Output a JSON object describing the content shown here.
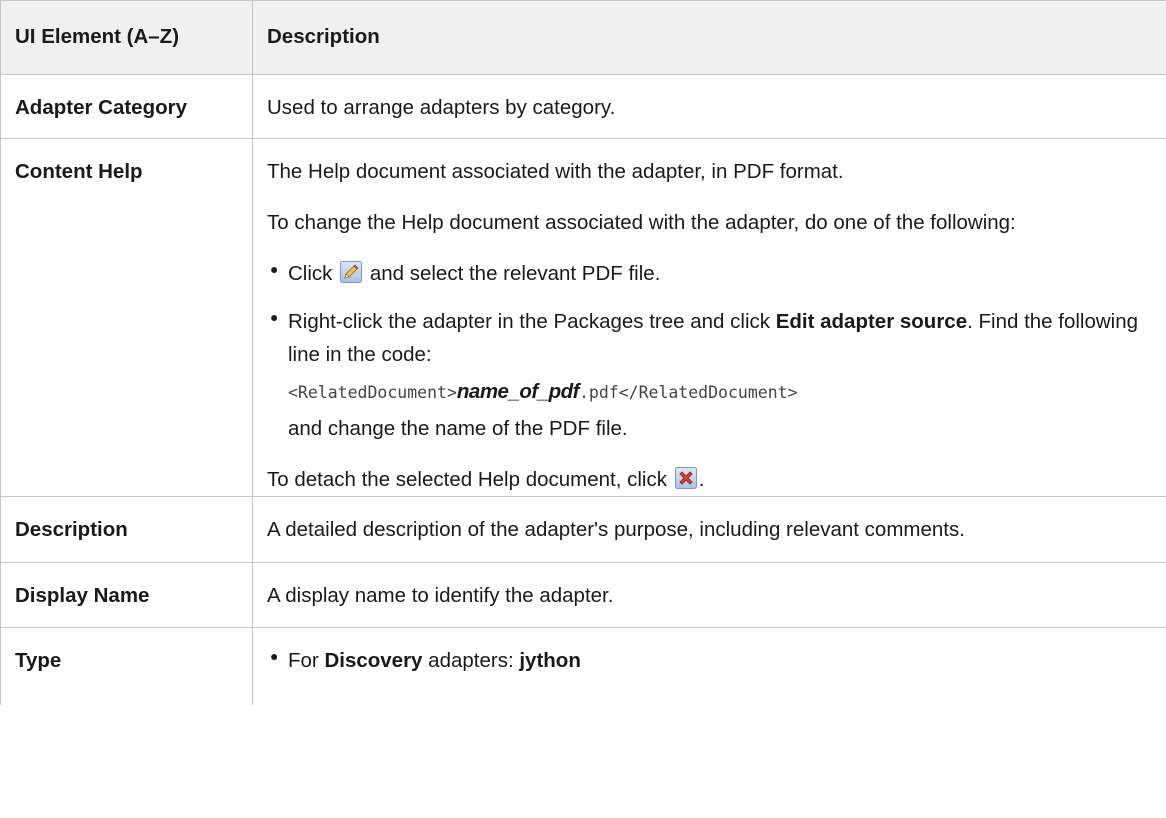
{
  "table": {
    "headers": {
      "element": "UI Element (A–Z)",
      "description": "Description"
    },
    "rows": {
      "adapter_category": {
        "element": "Adapter Category",
        "description": "Used to arrange adapters by category."
      },
      "content_help": {
        "element": "Content Help",
        "p1": "The Help document associated with the adapter, in PDF format.",
        "p2": "To change the Help document associated with the adapter, do one of the following:",
        "bullet1_before": "Click",
        "bullet1_after": "and select the relevant PDF file.",
        "bullet2_part1": "Right-click the adapter in the Packages tree and click",
        "bullet2_bold1": "Edit adapter source",
        "bullet2_part2": ". Find the following line in the code:",
        "code_prefix": "<RelatedDocument>",
        "code_italic": "name_of_pdf",
        "code_suffix": ".pdf</RelatedDocument>",
        "bullet2_tail": "and change the name of the PDF file.",
        "p3_before": "To detach the selected Help document, click",
        "p3_after": "."
      },
      "description": {
        "element": "Description",
        "description": "A detailed description of the adapter's purpose, including relevant comments."
      },
      "display_name": {
        "element": "Display Name",
        "description": "A display name to identify the adapter."
      },
      "type": {
        "element": "Type",
        "bullet_before": "For",
        "bullet_bold1": "Discovery",
        "bullet_middle": "adapters:",
        "bullet_bold2": "jython"
      }
    }
  },
  "icons": {
    "edit": "pencil-edit-icon",
    "remove": "red-x-delete-icon"
  }
}
